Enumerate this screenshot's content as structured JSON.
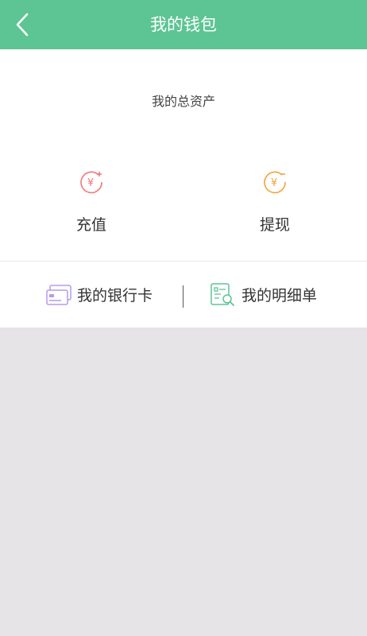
{
  "header": {
    "title": "我的钱包",
    "back_icon": "chevron-left-icon"
  },
  "wallet": {
    "total_assets_label": "我的总资产"
  },
  "actions": {
    "recharge": {
      "label": "充值",
      "icon": "yuan-plus-icon",
      "color": "#f0787a"
    },
    "withdraw": {
      "label": "提现",
      "icon": "yuan-minus-icon",
      "color": "#f2a43a"
    }
  },
  "links": {
    "bank_card": {
      "label": "我的银行卡",
      "icon": "bank-card-icon",
      "color": "#b59be8"
    },
    "bill": {
      "label": "我的明细单",
      "icon": "bill-details-icon",
      "color": "#5cc593"
    }
  },
  "colors": {
    "header_bg": "#5cc593",
    "page_bg": "#e6e4e7"
  }
}
